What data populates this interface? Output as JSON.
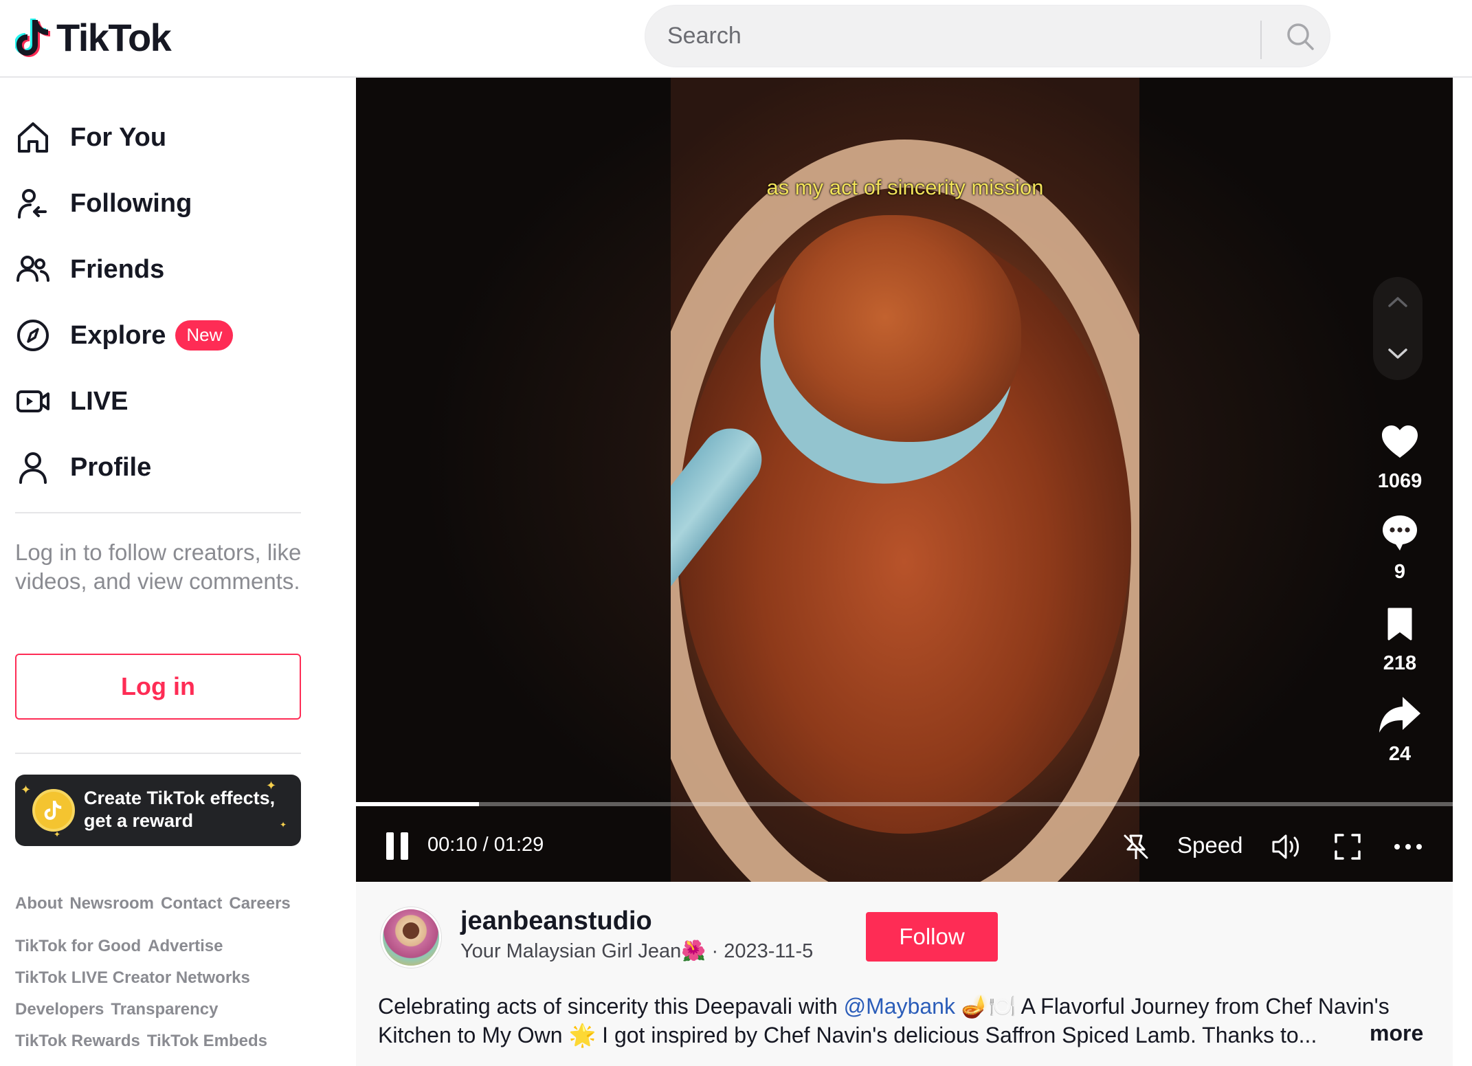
{
  "app": {
    "name": "TikTok"
  },
  "search": {
    "placeholder": "Search"
  },
  "sidebar": {
    "items": [
      {
        "label": "For You",
        "icon": "home-icon"
      },
      {
        "label": "Following",
        "icon": "following-icon"
      },
      {
        "label": "Friends",
        "icon": "friends-icon"
      },
      {
        "label": "Explore",
        "icon": "compass-icon",
        "badge": "New"
      },
      {
        "label": "LIVE",
        "icon": "live-icon"
      },
      {
        "label": "Profile",
        "icon": "profile-icon"
      }
    ],
    "login_prompt": "Log in to follow creators, like videos, and view comments.",
    "login_button": "Log in",
    "effects_banner": {
      "line1": "Create TikTok effects,",
      "line2": "get a reward"
    },
    "footer": [
      [
        "About",
        "Newsroom",
        "Contact",
        "Careers"
      ],
      [
        "TikTok for Good",
        "Advertise"
      ],
      [
        "TikTok LIVE Creator Networks"
      ],
      [
        "Developers",
        "Transparency"
      ],
      [
        "TikTok Rewards",
        "TikTok Embeds"
      ]
    ]
  },
  "video": {
    "caption": "as my act of sincerity mission",
    "time": "00:10 / 01:29",
    "progress": 0.112,
    "speed_label": "Speed",
    "actions": {
      "likes": "1069",
      "comments": "9",
      "saves": "218",
      "shares": "24"
    }
  },
  "post": {
    "username": "jeanbeanstudio",
    "display_name": "Your Malaysian Girl Jean🌺",
    "date": "2023-11-5",
    "follow_label": "Follow",
    "desc_part1": "Celebrating acts of sincerity this Deepavali with ",
    "mention": "@Maybank",
    "desc_part2": " 🪔🍽️ A Flavorful Journey from Chef Navin's Kitchen to My Own 🌟 I got inspired by Chef Navin's delicious Saffron Spiced Lamb. Thanks to...",
    "more_label": "more"
  },
  "colors": {
    "accent": "#fe2c55",
    "mention": "#2b5db9",
    "text": "#161823"
  }
}
